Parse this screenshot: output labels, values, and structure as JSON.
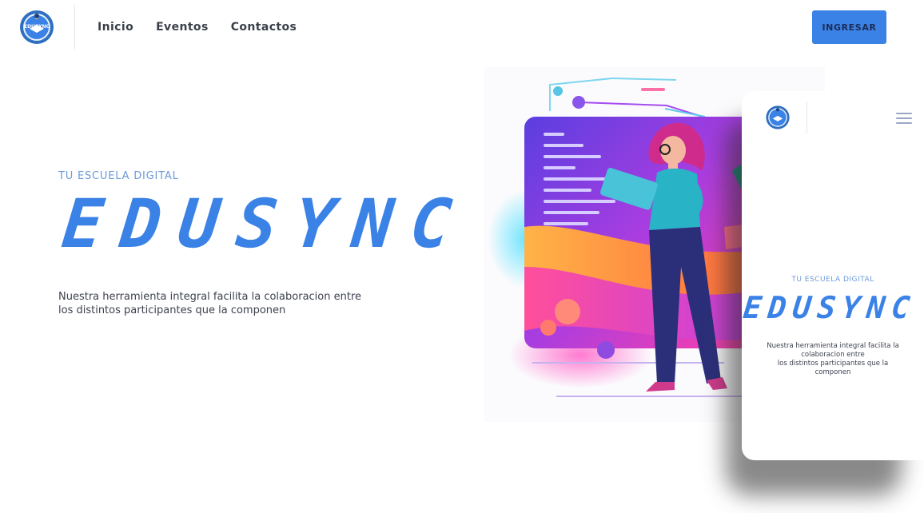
{
  "header": {
    "logo_text": "EDUSYNC",
    "logo_icon": "edusync-logo-icon",
    "nav": [
      {
        "label": "Inicio"
      },
      {
        "label": "Eventos"
      },
      {
        "label": "Contactos"
      }
    ],
    "login_label": "INGRESAR"
  },
  "hero": {
    "eyebrow": "TU ESCUELA DIGITAL",
    "brand": "EDUSYNC",
    "description_line1": "Nuestra herramienta integral facilita la colaboracion entre",
    "description_line2": "los distintos participantes que la componen",
    "illustration": "woman-with-tablet-dashboard-illustration"
  },
  "mobile_preview": {
    "logo_icon": "edusync-logo-icon",
    "menu_icon": "hamburger-menu-icon",
    "eyebrow": "TU ESCUELA DIGITAL",
    "brand": "EDUSYNC",
    "description_line1": "Nuestra herramienta integral facilita la",
    "description_line2": "colaboracion entre",
    "description_line3": "los distintos participantes que la",
    "description_line4": "componen"
  },
  "colors": {
    "accent": "#3b82e6",
    "eyebrow": "#6c9ad8",
    "text": "#3d4250"
  }
}
